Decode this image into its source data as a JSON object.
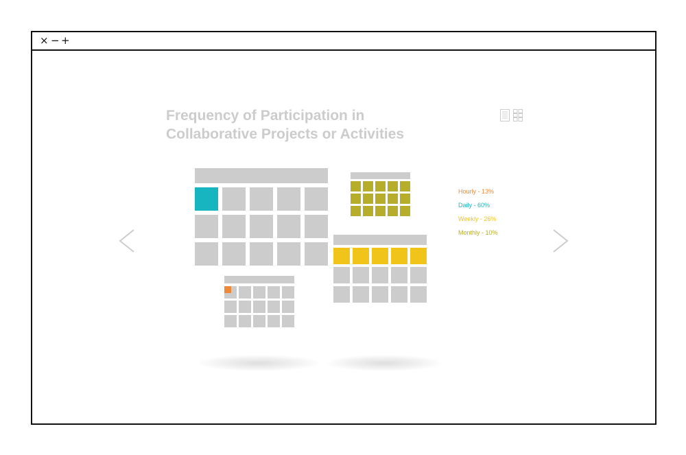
{
  "window": {
    "controls": {
      "close": "×",
      "minimize": "−",
      "maximize": "+"
    }
  },
  "chart_data": {
    "type": "pictogram",
    "title_line1": "Frequency of Participation in",
    "title_line2": "Collaborative Projects or Activities",
    "legend": [
      {
        "label": "Hourly - 13%",
        "color": "#f0883a"
      },
      {
        "label": "Daily - 60%",
        "color": "#16b5c0"
      },
      {
        "label": "Weekly - 26%",
        "color": "#f0c419"
      },
      {
        "label": "Monthly - 10%",
        "color": "#b6ad2a"
      }
    ],
    "categories": [
      "Hourly",
      "Daily",
      "Weekly",
      "Monthly"
    ],
    "values": [
      13,
      60,
      26,
      10
    ],
    "calendars": [
      {
        "category": "Daily",
        "highlight_color": "#16b5c0",
        "rows": 3,
        "cols": 5,
        "highlight": "first-cell"
      },
      {
        "category": "Monthly",
        "highlight_color": "#b6ad2a",
        "rows": 3,
        "cols": 5,
        "highlight": "all"
      },
      {
        "category": "Weekly",
        "highlight_color": "#f0c419",
        "rows": 3,
        "cols": 5,
        "highlight": "first-row"
      },
      {
        "category": "Hourly",
        "highlight_color": "#f0883a",
        "rows": 3,
        "cols": 5,
        "highlight": "first-cell-partial"
      }
    ],
    "neutral_color": "#cccccc"
  },
  "icons": {
    "list_view": "list-view-icon",
    "grid_view": "grid-view-icon",
    "prev": "chevron-left-icon",
    "next": "chevron-right-icon"
  }
}
